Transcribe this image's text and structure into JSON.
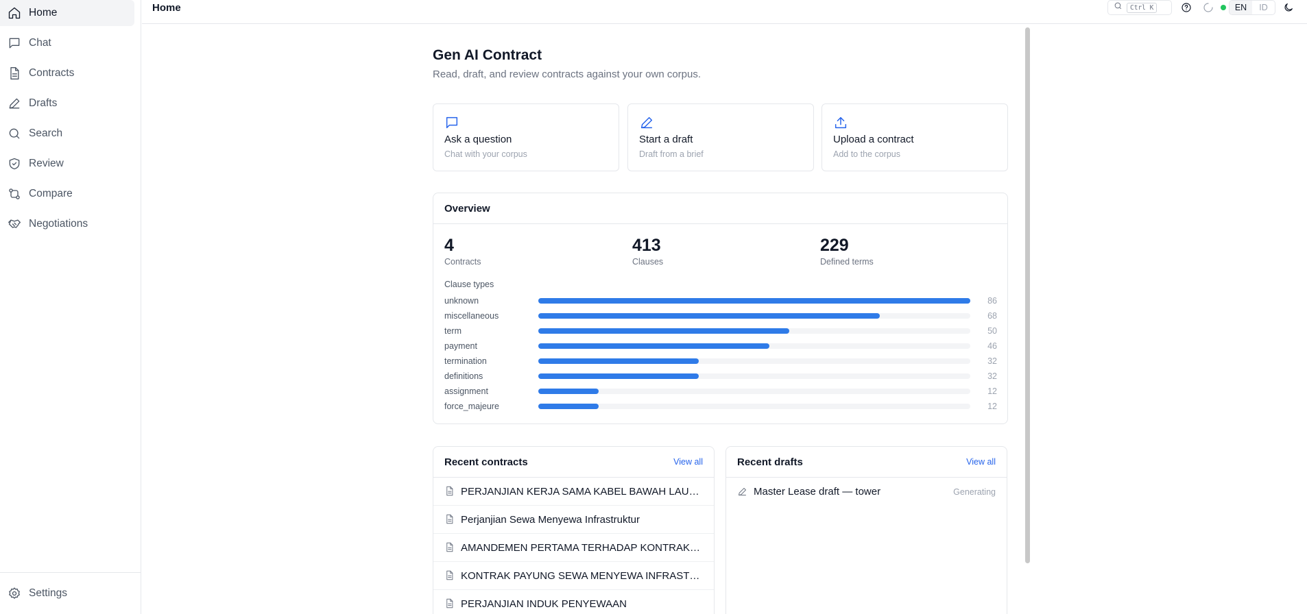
{
  "app": {
    "page_title": "Home"
  },
  "sidebar": {
    "items": [
      {
        "label": "Home",
        "icon": "home-icon",
        "active": true
      },
      {
        "label": "Chat",
        "icon": "chat-icon"
      },
      {
        "label": "Contracts",
        "icon": "file-icon"
      },
      {
        "label": "Drafts",
        "icon": "pen-icon"
      },
      {
        "label": "Search",
        "icon": "search-icon"
      },
      {
        "label": "Review",
        "icon": "shield-check-icon"
      },
      {
        "label": "Compare",
        "icon": "compare-icon"
      },
      {
        "label": "Negotiations",
        "icon": "handshake-icon"
      }
    ],
    "settings_label": "Settings"
  },
  "topbar": {
    "search_shortcut": "Ctrl K",
    "lang_en": "EN",
    "lang_id": "ID",
    "status_color": "#22c55e"
  },
  "hero": {
    "title": "Gen AI Contract",
    "subtitle": "Read, draft, and review contracts against your own corpus."
  },
  "actions": [
    {
      "title": "Ask a question",
      "subtitle": "Chat with your corpus",
      "icon": "chat-icon"
    },
    {
      "title": "Start a draft",
      "subtitle": "Draft from a brief",
      "icon": "pen-icon"
    },
    {
      "title": "Upload a contract",
      "subtitle": "Add to the corpus",
      "icon": "upload-icon"
    }
  ],
  "overview": {
    "title": "Overview",
    "stats": [
      {
        "value": "4",
        "label": "Contracts"
      },
      {
        "value": "413",
        "label": "Clauses"
      },
      {
        "value": "229",
        "label": "Defined terms"
      }
    ],
    "clause_types_title": "Clause types",
    "accent_color": "#2f7be8",
    "clause_types": [
      {
        "label": "unknown",
        "value": 86
      },
      {
        "label": "miscellaneous",
        "value": 68
      },
      {
        "label": "term",
        "value": 50
      },
      {
        "label": "payment",
        "value": 46
      },
      {
        "label": "termination",
        "value": 32
      },
      {
        "label": "definitions",
        "value": 32
      },
      {
        "label": "assignment",
        "value": 12
      },
      {
        "label": "force_majeure",
        "value": 12
      }
    ]
  },
  "recent_contracts": {
    "title": "Recent contracts",
    "view_all": "View all",
    "items": [
      "PERJANJIAN KERJA SAMA KABEL BAWAH LAUT / ...",
      "Perjanjian Sewa Menyewa Infrastruktur",
      "AMANDEMEN PERTAMA TERHADAP KONTRAK PA...",
      "KONTRAK PAYUNG SEWA MENYEWA INFRASTRUK...",
      "PERJANJIAN INDUK PENYEWAAN"
    ]
  },
  "recent_drafts": {
    "title": "Recent drafts",
    "view_all": "View all",
    "items": [
      {
        "title": "Master Lease draft — tower",
        "status": "Generating"
      }
    ]
  }
}
